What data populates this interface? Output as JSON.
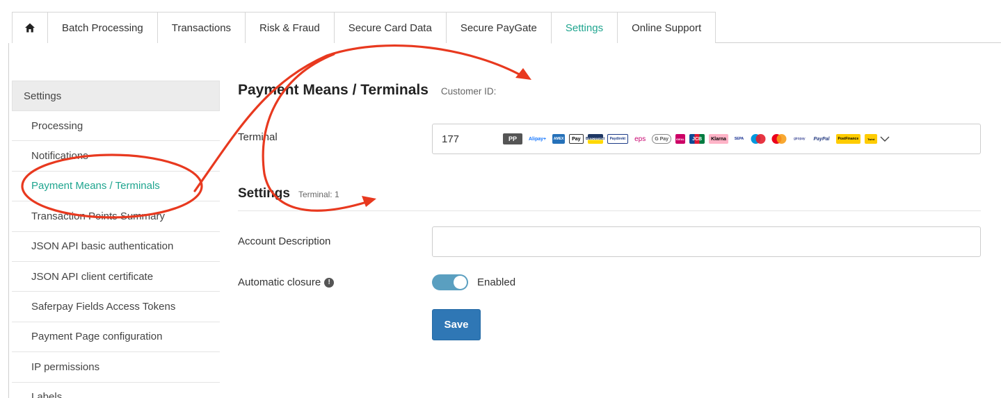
{
  "nav": {
    "tabs": [
      {
        "label": "Batch Processing"
      },
      {
        "label": "Transactions"
      },
      {
        "label": "Risk & Fraud"
      },
      {
        "label": "Secure Card Data"
      },
      {
        "label": "Secure PayGate"
      },
      {
        "label": "Settings",
        "active": true
      },
      {
        "label": "Online Support"
      }
    ]
  },
  "sidebar": {
    "header": "Settings",
    "items": [
      {
        "label": "Processing"
      },
      {
        "label": "Notifications"
      },
      {
        "label": "Payment Means / Terminals",
        "active": true
      },
      {
        "label": "Transaction Points Summary"
      },
      {
        "label": "JSON API basic authentication"
      },
      {
        "label": "JSON API client certificate"
      },
      {
        "label": "Saferpay Fields Access Tokens"
      },
      {
        "label": "Payment Page configuration"
      },
      {
        "label": "IP permissions"
      },
      {
        "label": "Labels"
      }
    ]
  },
  "main": {
    "title": "Payment Means / Terminals",
    "customer_id_label": "Customer ID:",
    "terminal_label": "Terminal",
    "terminal_value": "177",
    "payment_logos": [
      "PP",
      "Alipay+",
      "AMEX",
      "Pay",
      "Bancontact",
      "Paydirekt",
      "eps",
      "G Pay",
      "iDEAL",
      "JCB",
      "Klarna",
      "SEPA",
      "Maestro",
      "Mastercard",
      "giropay",
      "PayPal",
      "PostFinance",
      "Twint"
    ],
    "settings_title": "Settings",
    "terminal_sub": "Terminal: 1",
    "account_description_label": "Account Description",
    "account_description_value": "",
    "automatic_closure_label": "Automatic closure",
    "automatic_closure_state": "Enabled",
    "save_label": "Save"
  },
  "colors": {
    "accent": "#1fa58f",
    "button": "#2f77b5",
    "toggle": "#5a9fc0",
    "annotation": "#e8391f"
  }
}
